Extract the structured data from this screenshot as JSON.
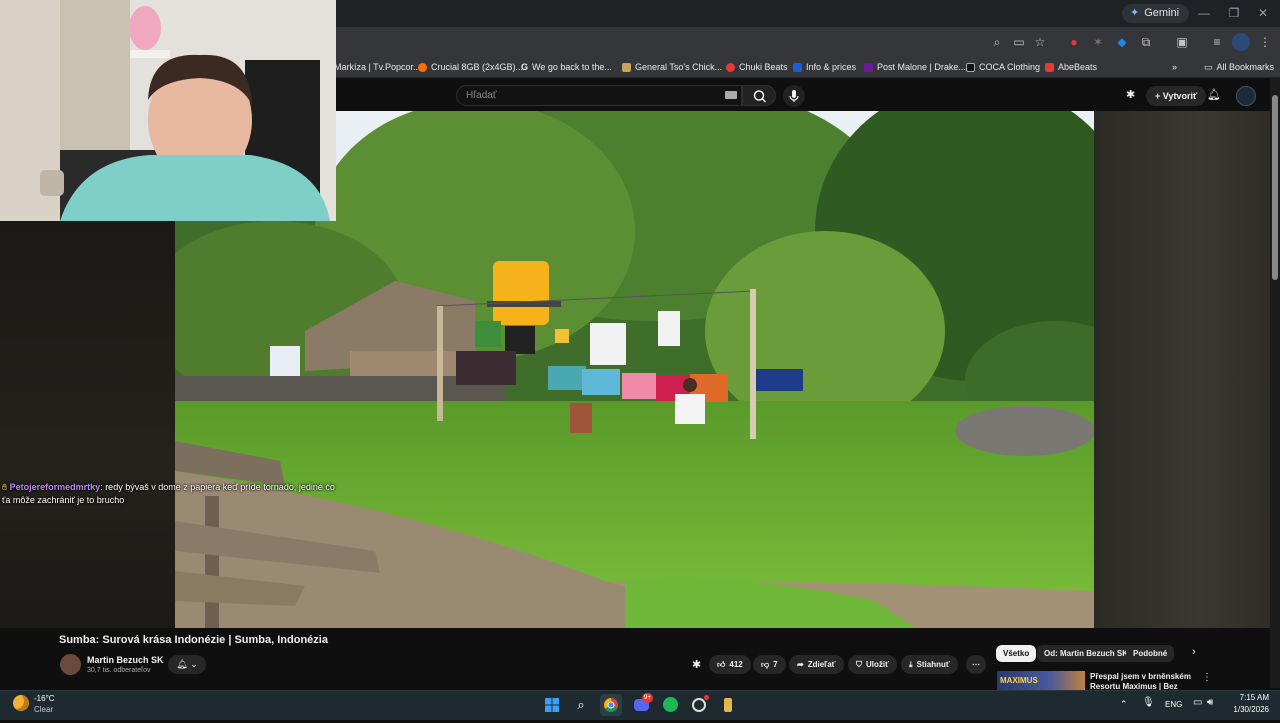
{
  "browser": {
    "gemini_label": "Gemini",
    "bookmarks": [
      {
        "label": "Markíza | Tv.Popcor...",
        "color": "#e53935"
      },
      {
        "label": "Crucial 8GB (2x4GB)...",
        "color": "#ff6f00"
      },
      {
        "label": "We go back to the...",
        "color": "#ffffff"
      },
      {
        "label": "General Tso's Chick...",
        "color": "#c8a060"
      },
      {
        "label": "Chuki Beats",
        "color": "#e53935"
      },
      {
        "label": "Info & prices",
        "color": "#1e5bd6"
      },
      {
        "label": "Post Malone | Drake...",
        "color": "#6a1b9a"
      },
      {
        "label": "COCA Clothing",
        "color": "#111111"
      },
      {
        "label": "AbeBeats",
        "color": "#e53935"
      }
    ],
    "all_bookmarks_label": "All Bookmarks",
    "more_icon": "chevron-double-right-icon"
  },
  "youtube": {
    "search_placeholder": "Hľadať",
    "create_label": "Vytvoriť",
    "video_title": "Sumba: Surová krása Indonézie | Sumba, Indonézia",
    "channel_name": "Martin Bezuch SK",
    "subscribers": "30,7 tis. odberateľov",
    "likes": "412",
    "dislikes": "7",
    "share_label": "Zdieľať",
    "save_label": "Uložiť",
    "download_label": "Stiahnuť",
    "chips": [
      "Všetko",
      "Od: Martin Bezuch SK",
      "Podobné"
    ],
    "ad_brand": "MAXIMUS",
    "ad_text": "Přespal jsem v brněnském Resortu Maximus | Bez obaluk"
  },
  "chat": {
    "user": "Petojereformedmrtky",
    "message": ": redy bývaš v dome z papiera keď príde tornado, jediné čo ťa môže zachrániť je to brucho"
  },
  "taskbar": {
    "temperature": "-16°C",
    "weather": "Clear",
    "language": "ENG",
    "time": "7:15 AM",
    "date": "1/30/2026",
    "discord_badge": "9+"
  }
}
